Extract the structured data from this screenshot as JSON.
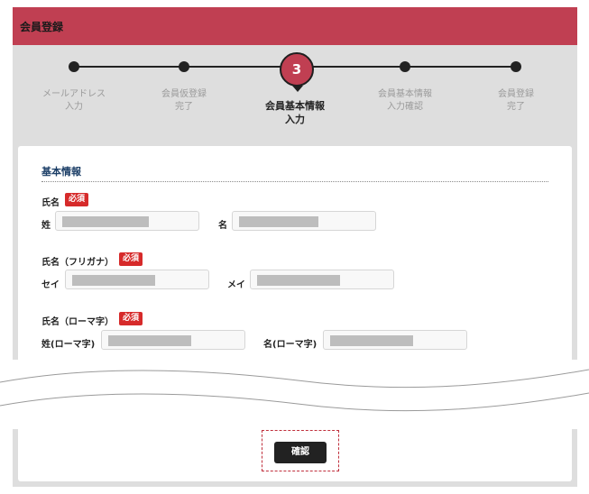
{
  "header": {
    "title": "会員登録",
    "color": "#c03f52"
  },
  "stepper": {
    "active_number": "3",
    "steps": [
      {
        "label": "メールアドレス\n入力"
      },
      {
        "label": "会員仮登録\n完了"
      },
      {
        "label": "会員基本情報\n入力"
      },
      {
        "label": "会員基本情報\n入力確認"
      },
      {
        "label": "会員登録\n完了"
      }
    ]
  },
  "form": {
    "section_title": "基本情報",
    "required_badge": "必須",
    "name": {
      "title": "氏名",
      "last_label": "姓",
      "first_label": "名"
    },
    "kana": {
      "title": "氏名（フリガナ）",
      "last_label": "セイ",
      "first_label": "メイ"
    },
    "roman": {
      "title": "氏名（ローマ字）",
      "last_label": "姓(ローマ字)",
      "first_label": "名(ローマ字)"
    }
  },
  "actions": {
    "confirm_label": "確認"
  }
}
